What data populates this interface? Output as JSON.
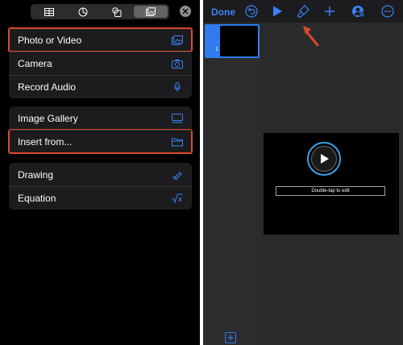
{
  "insert_panel": {
    "tabs": [
      {
        "icon": "table-icon"
      },
      {
        "icon": "chart-icon"
      },
      {
        "icon": "shapes-icon"
      },
      {
        "icon": "media-icon",
        "active": true
      }
    ],
    "close_icon": "close-icon",
    "groups": [
      {
        "items": [
          {
            "label": "Photo or Video",
            "icon": "photo-library-icon",
            "highlighted": true
          },
          {
            "label": "Camera",
            "icon": "camera-icon"
          },
          {
            "label": "Record Audio",
            "icon": "microphone-icon"
          }
        ]
      },
      {
        "items": [
          {
            "label": "Image Gallery",
            "icon": "image-gallery-icon"
          },
          {
            "label": "Insert from...",
            "icon": "folder-icon",
            "highlighted": true
          }
        ]
      },
      {
        "items": [
          {
            "label": "Drawing",
            "icon": "pencil-draw-icon"
          },
          {
            "label": "Equation",
            "icon": "square-root-icon"
          }
        ]
      }
    ]
  },
  "editor": {
    "toolbar": {
      "done_label": "Done",
      "icons": [
        "undo-icon",
        "play-icon",
        "format-brush-icon",
        "add-icon",
        "collaborate-icon",
        "more-icon"
      ]
    },
    "slides": [
      {
        "number": "1"
      }
    ],
    "slide": {
      "caption": "Double-tap to edit"
    },
    "colors": {
      "accent": "#3b82f6",
      "highlight": "#d9492c"
    }
  }
}
